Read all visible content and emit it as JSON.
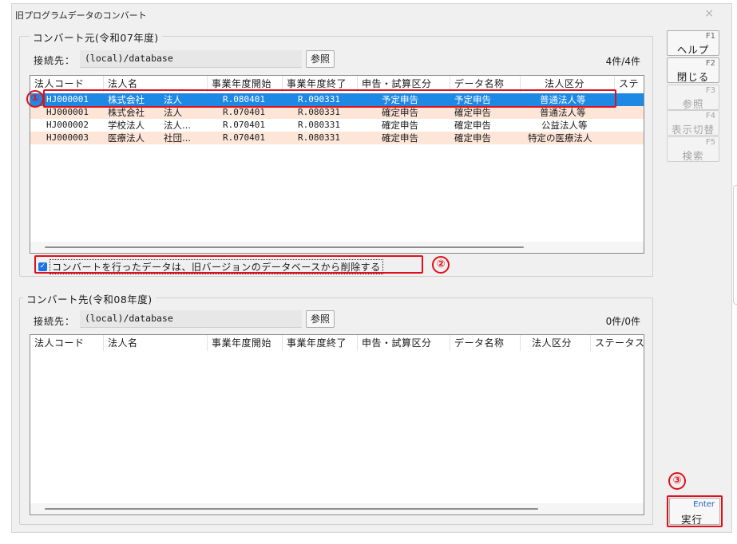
{
  "window": {
    "title": "旧プログラムデータのコンバート",
    "close_label": "×"
  },
  "source": {
    "legend": "コンバート元(令和07年度)",
    "conn_label": "接続先：",
    "conn_value": "(local)/database",
    "ref_label": "参照",
    "count": "4件/4件",
    "columns": [
      "法人コード",
      "法人名",
      "事業年度開始",
      "事業年度終了",
      "申告・試算区分",
      "データ名称",
      "法人区分",
      "ステ"
    ],
    "rows": [
      {
        "code": "HJ000001",
        "name1": "株式会社",
        "name2": "法人",
        "start": "R.080401",
        "end": "R.090331",
        "kubun": "予定申告",
        "dataname": "予定申告",
        "hojin": "普通法人等"
      },
      {
        "code": "HJ000001",
        "name1": "株式会社",
        "name2": "法人",
        "start": "R.070401",
        "end": "R.080331",
        "kubun": "確定申告",
        "dataname": "確定申告",
        "hojin": "普通法人等"
      },
      {
        "code": "HJ000002",
        "name1": "学校法人",
        "name2": "法人...",
        "start": "R.070401",
        "end": "R.080331",
        "kubun": "確定申告",
        "dataname": "確定申告",
        "hojin": "公益法人等"
      },
      {
        "code": "HJ000003",
        "name1": "医療法人",
        "name2": "社団...",
        "start": "R.070401",
        "end": "R.080331",
        "kubun": "確定申告",
        "dataname": "確定申告",
        "hojin": "特定の医療法人"
      }
    ],
    "delete_checkbox_label": "コンバートを行ったデータは、旧バージョンのデータベースから削除する",
    "delete_checked": true
  },
  "dest": {
    "legend": "コンバート先(令和08年度)",
    "conn_label": "接続先：",
    "conn_value": "(local)/database",
    "ref_label": "参照",
    "count": "0件/0件",
    "columns": [
      "法人コード",
      "法人名",
      "事業年度開始",
      "事業年度終了",
      "申告・試算区分",
      "データ名称",
      "法人区分",
      "ステータス"
    ]
  },
  "fkeys": [
    {
      "key": "F1",
      "label": "ヘルプ",
      "enabled": true
    },
    {
      "key": "F2",
      "label": "閉じる",
      "enabled": true
    },
    {
      "key": "F3",
      "label": "参照",
      "enabled": false
    },
    {
      "key": "F4",
      "label": "表示切替",
      "enabled": false
    },
    {
      "key": "F5",
      "label": "検索",
      "enabled": false
    }
  ],
  "execute": {
    "key": "Enter",
    "label": "実行"
  },
  "callouts": {
    "c1": "①",
    "c2": "②",
    "c3": "③"
  },
  "colors": {
    "selected_row": "#1e88e5",
    "alt_row": "#fde6d8",
    "callout": "#e0101a"
  }
}
